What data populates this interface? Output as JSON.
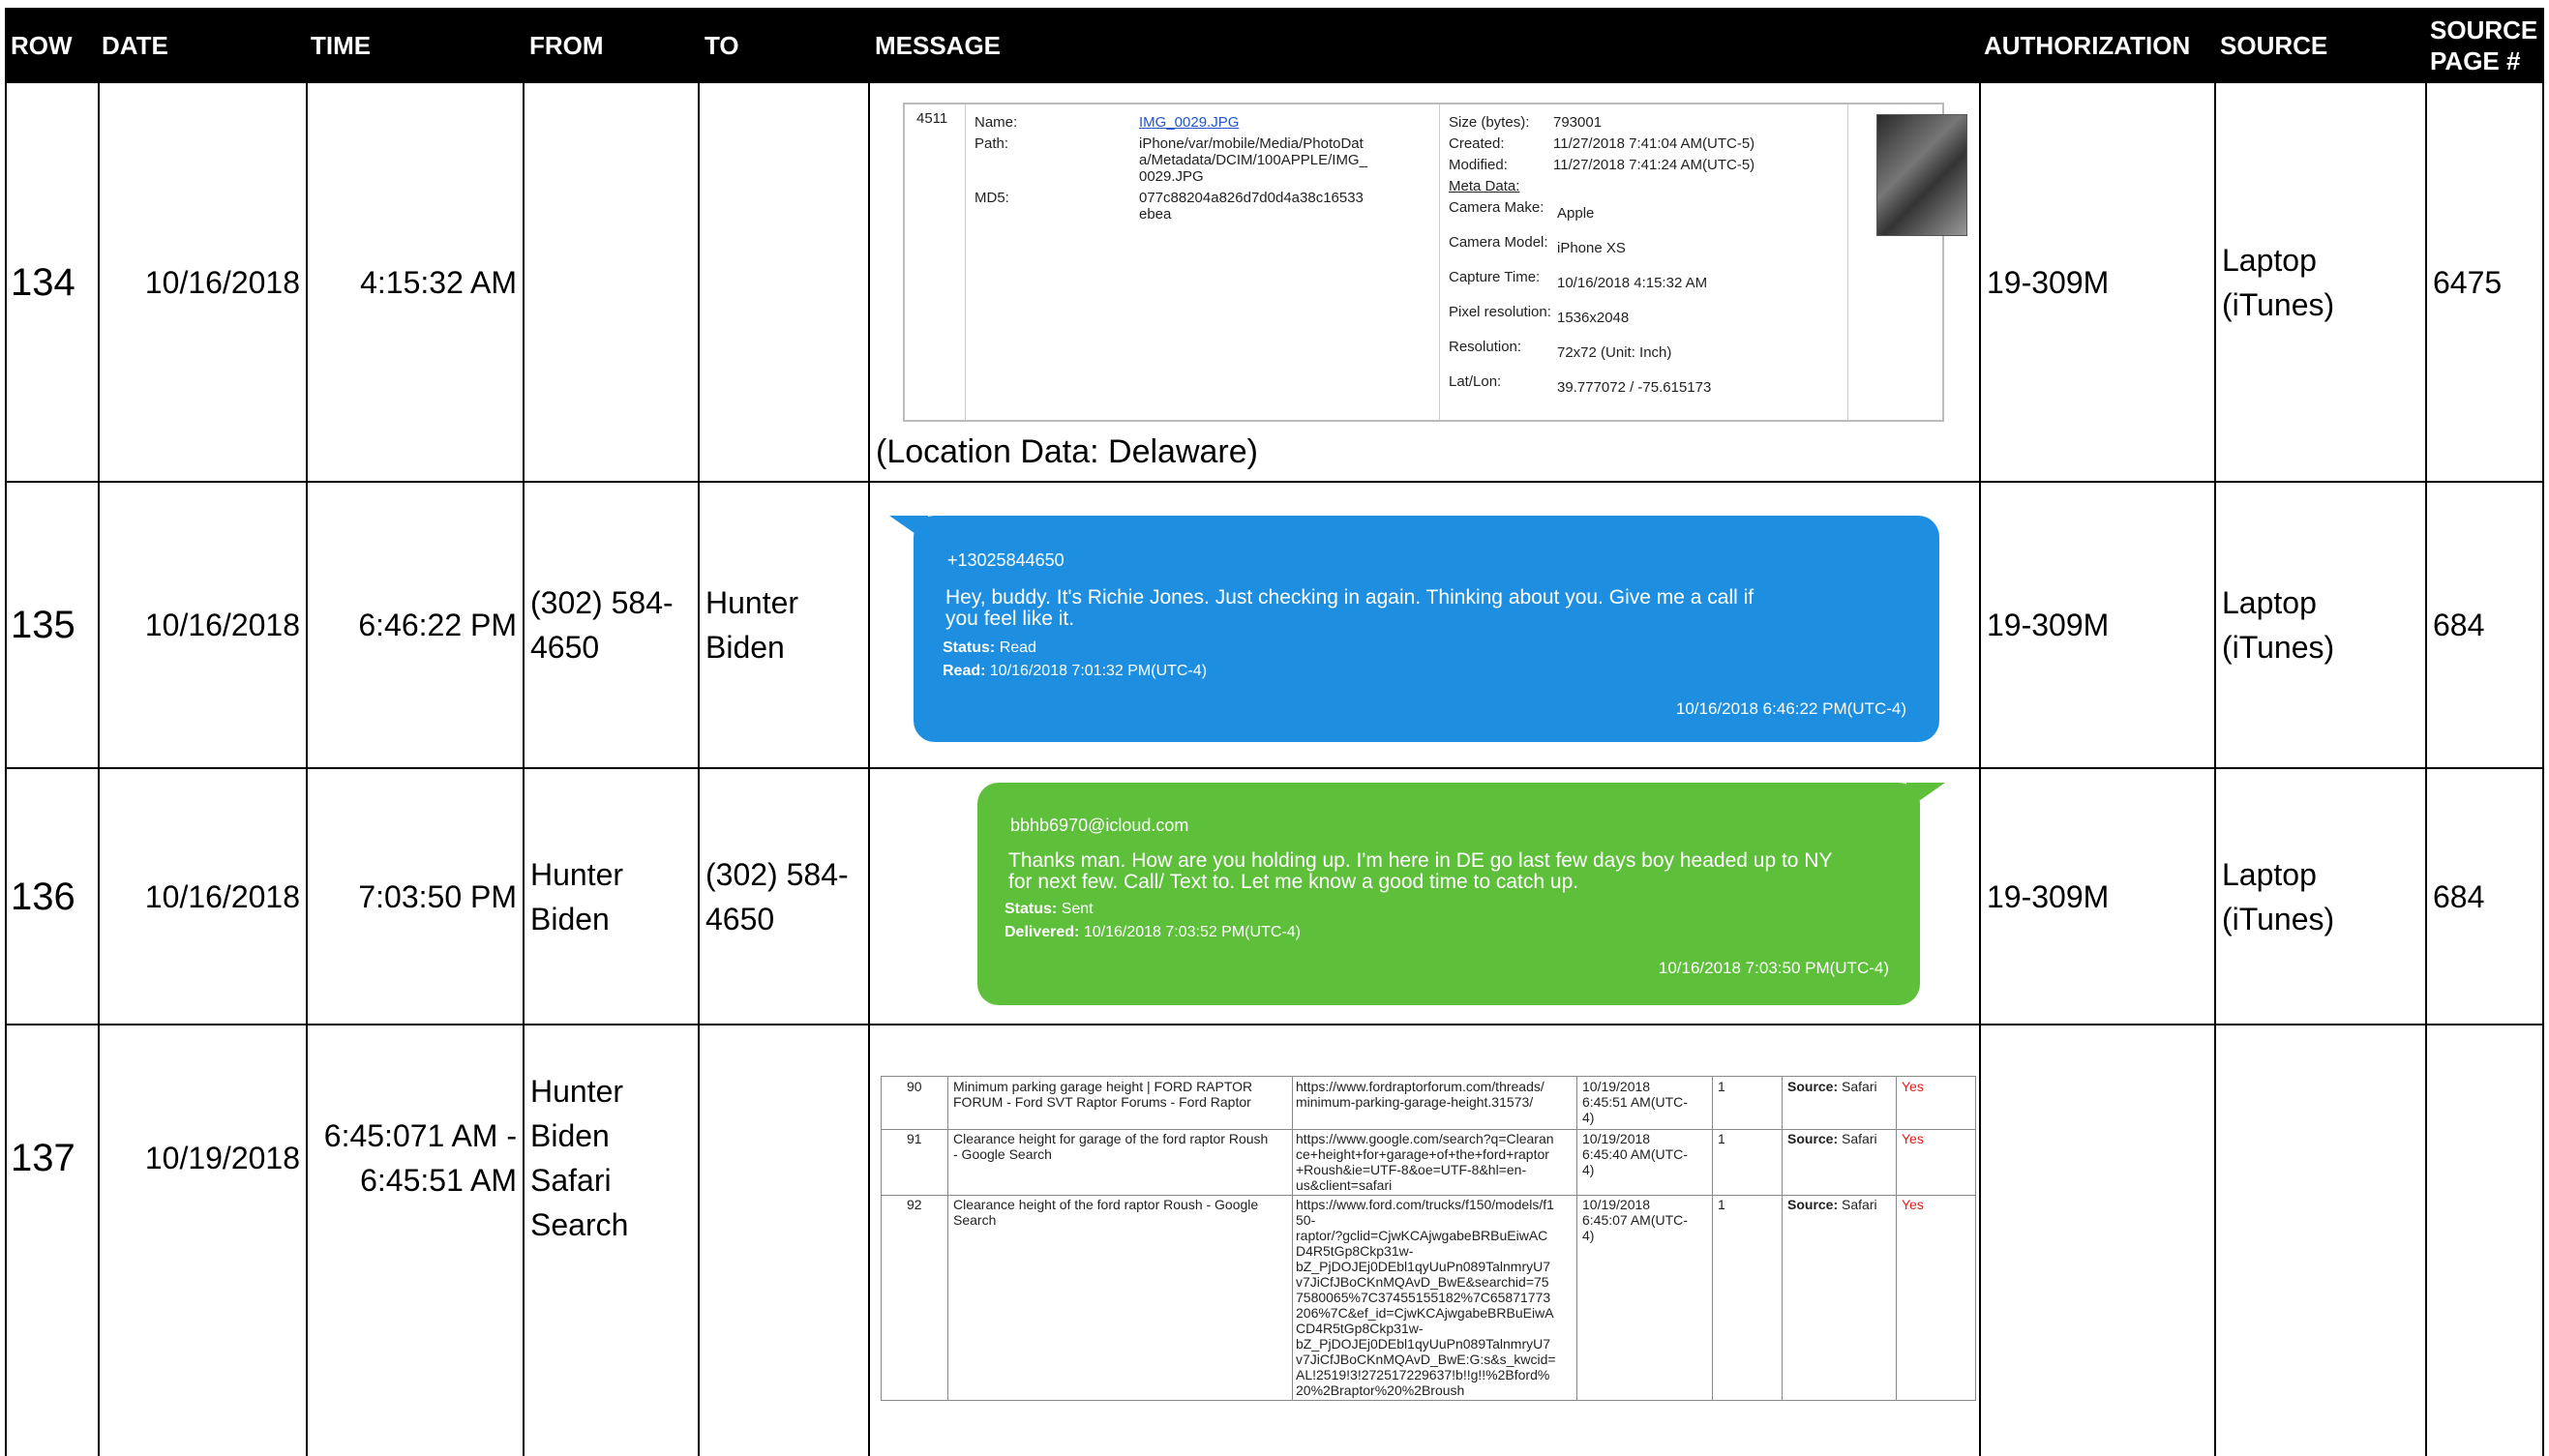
{
  "header": {
    "row": "ROW",
    "date": "DATE",
    "time": "TIME",
    "from": "FROM",
    "to": "TO",
    "message": "MESSAGE",
    "authorization": "AUTHORIZATION",
    "source": "SOURCE",
    "source_page_line1": "SOURCE",
    "source_page_line2": "PAGE #"
  },
  "rows": [
    {
      "row": "134",
      "date": "10/16/2018",
      "time": "4:15:32 AM",
      "from": "",
      "to": "",
      "authorization": "19-309M",
      "source_line1": "Laptop",
      "source_line2": "(iTunes)",
      "page": "6475",
      "file": {
        "index": "4511",
        "name_label": "Name:",
        "name_value": "IMG_0029.JPG",
        "path_label": "Path:",
        "path_value": [
          "iPhone/var/mobile/Media/PhotoDat",
          "a/Metadata/DCIM/100APPLE/IMG_",
          "0029.JPG"
        ],
        "md5_label": "MD5:",
        "md5_value": [
          "077c88204a826d7d0d4a38c16533",
          "ebea"
        ],
        "size_label": "Size (bytes):",
        "size_value": "793001",
        "created_label": "Created:",
        "created_value": "11/27/2018 7:41:04 AM(UTC-5)",
        "modified_label": "Modified:",
        "modified_value": "11/27/2018 7:41:24 AM(UTC-5)",
        "meta_label": "Meta Data:",
        "make_label": "Camera Make:",
        "make_value": "Apple",
        "model_label": "Camera Model:",
        "model_value": "iPhone XS",
        "capture_label": "Capture Time:",
        "capture_value": "10/16/2018 4:15:32 AM",
        "pixel_label": "Pixel resolution:",
        "pixel_value": "1536x2048",
        "res_label": "Resolution:",
        "res_value": "72x72 (Unit: Inch)",
        "latlon_label": "Lat/Lon:",
        "latlon_value": "39.777072 / -75.615173"
      },
      "note": "(Location Data: Delaware)"
    },
    {
      "row": "135",
      "date": "10/16/2018",
      "time": "6:46:22 PM",
      "from_line1": "(302) 584-",
      "from_line2": "4650",
      "to_line1": "Hunter",
      "to_line2": "Biden",
      "authorization": "19-309M",
      "source_line1": "Laptop",
      "source_line2": "(iTunes)",
      "page": "684",
      "bubble": {
        "sender": "+13025844650",
        "text_line1": "Hey, buddy. It's Richie Jones. Just checking in again. Thinking about you. Give me a call if",
        "text_line2": "you feel like it.",
        "status_label": "Status:",
        "status_value": "Read",
        "read_label": "Read:",
        "read_value": "10/16/2018 7:01:32 PM(UTC-4)",
        "timestamp": "10/16/2018 6:46:22 PM(UTC-4)",
        "color": "#1e8fe0"
      }
    },
    {
      "row": "136",
      "date": "10/16/2018",
      "time": "7:03:50 PM",
      "from_line1": "Hunter",
      "from_line2": "Biden",
      "to_line1": "(302) 584-",
      "to_line2": "4650",
      "authorization": "19-309M",
      "source_line1": "Laptop",
      "source_line2": "(iTunes)",
      "page": "684",
      "bubble": {
        "sender": "bbhb6970@icloud.com",
        "text_line1": "Thanks man. How are you holding up. I'm here in DE go last few days boy headed up to NY",
        "text_line2": "for next few. Call/ Text to. Let me know a good time to catch up.",
        "status_label": "Status:",
        "status_value": "Sent",
        "delivered_label": "Delivered:",
        "delivered_value": "10/16/2018 7:03:52 PM(UTC-4)",
        "timestamp": "10/16/2018 7:03:50 PM(UTC-4)",
        "color": "#5dbf3a"
      }
    },
    {
      "row": "137",
      "date": "10/19/2018",
      "time_line1": "6:45:071 AM -",
      "time_line2": "6:45:51 AM",
      "from_line1": "Hunter",
      "from_line2": "Biden",
      "from_line3": "Safari",
      "from_line4": "Search",
      "to": "",
      "authorization": "",
      "source": "",
      "page": "",
      "history": [
        {
          "num": "90",
          "title": [
            "Minimum parking garage height | FORD RAPTOR",
            "FORUM - Ford SVT Raptor Forums - Ford Raptor"
          ],
          "url": [
            "https://www.fordraptorforum.com/threads/",
            "minimum-parking-garage-height.31573/"
          ],
          "date": [
            "10/19/2018",
            "6:45:51 AM(UTC-",
            "4)"
          ],
          "count": "1",
          "source_label": "Source:",
          "source_value": "Safari",
          "flag": "Yes"
        },
        {
          "num": "91",
          "title": [
            "Clearance height for garage of the ford raptor Roush",
            "- Google Search"
          ],
          "url": [
            "https://www.google.com/search?q=Clearan",
            "ce+height+for+garage+of+the+ford+raptor",
            "+Roush&ie=UTF-8&oe=UTF-8&hl=en-",
            "us&client=safari"
          ],
          "date": [
            "10/19/2018",
            "6:45:40 AM(UTC-",
            "4)"
          ],
          "count": "1",
          "source_label": "Source:",
          "source_value": "Safari",
          "flag": "Yes"
        },
        {
          "num": "92",
          "title": [
            "Clearance height of the ford raptor Roush - Google",
            "Search"
          ],
          "url": [
            "https://www.ford.com/trucks/f150/models/f1",
            "50-",
            "raptor/?gclid=CjwKCAjwgabeBRBuEiwAC",
            "D4R5tGp8Ckp31w-",
            "bZ_PjDOJEj0DEbl1qyUuPn089TalnmryU7",
            "v7JiCfJBoCKnMQAvD_BwE&searchid=75",
            "7580065%7C37455155182%7C65871773",
            "206%7C&ef_id=CjwKCAjwgabeBRBuEiwA",
            "CD4R5tGp8Ckp31w-",
            "bZ_PjDOJEj0DEbl1qyUuPn089TalnmryU7",
            "v7JiCfJBoCKnMQAvD_BwE:G:s&s_kwcid=",
            "AL!2519!3!272517229637!b!!g!!%2Bford%",
            "20%2Braptor%20%2Broush"
          ],
          "date": [
            "10/19/2018",
            "6:45:07 AM(UTC-",
            "4)"
          ],
          "count": "1",
          "source_label": "Source:",
          "source_value": "Safari",
          "flag": "Yes"
        }
      ]
    }
  ]
}
